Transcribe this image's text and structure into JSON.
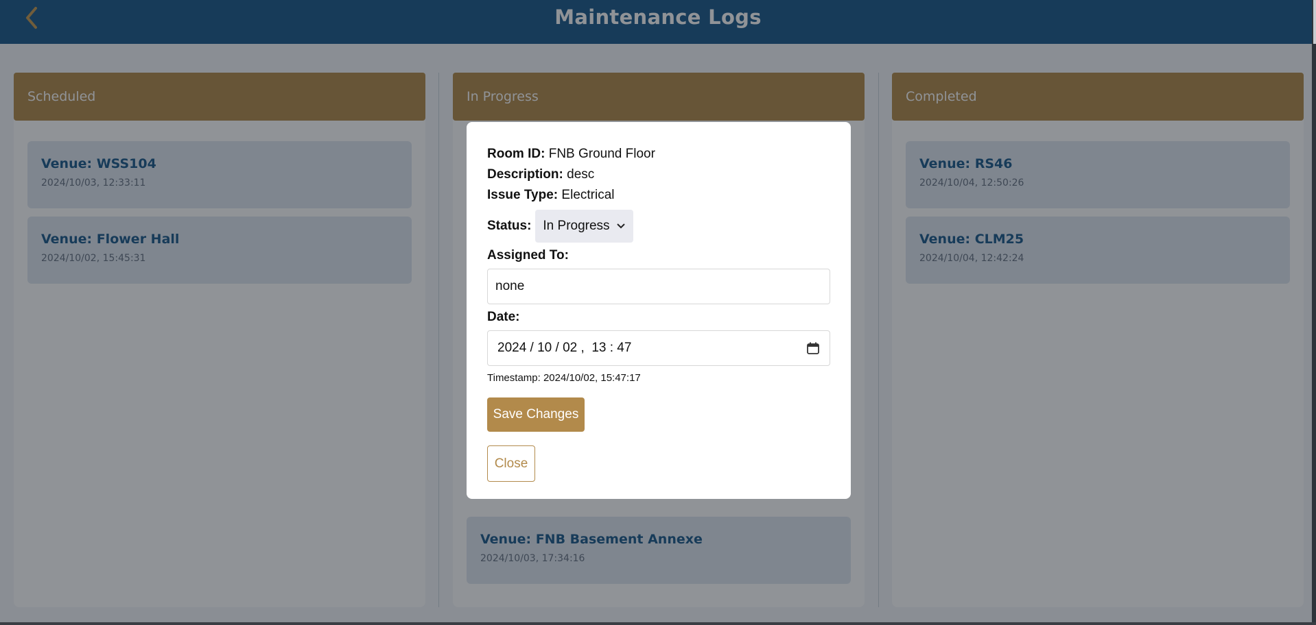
{
  "header": {
    "title": "Maintenance Logs"
  },
  "columns": [
    {
      "title": "Scheduled",
      "cards": [
        {
          "venue": "Venue: WSS104",
          "date": "2024/10/03, 12:33:11"
        },
        {
          "venue": "Venue: Flower Hall",
          "date": "2024/10/02, 15:45:31"
        }
      ]
    },
    {
      "title": "In Progress",
      "cards": [
        {
          "venue": "Venue: FNB Basement Annexe",
          "date": "2024/10/03, 17:34:16"
        }
      ]
    },
    {
      "title": "Completed",
      "cards": [
        {
          "venue": "Venue: RS46",
          "date": "2024/10/04, 12:50:26"
        },
        {
          "venue": "Venue: CLM25",
          "date": "2024/10/04, 12:42:24"
        }
      ]
    }
  ],
  "modal": {
    "room_label": "Room ID:",
    "room_value": "FNB Ground Floor",
    "description_label": "Description:",
    "description_value": "desc",
    "issue_label": "Issue Type:",
    "issue_value": "Electrical",
    "status_label": "Status:",
    "status_value": "In Progress",
    "assigned_label": "Assigned To:",
    "assigned_value": "none",
    "date_label": "Date:",
    "date_value": "2024 / 10 / 02 ,  13 : 47",
    "timestamp": "Timestamp: 2024/10/02, 15:47:17",
    "save_label": "Save Changes",
    "close_label": "Close"
  },
  "colors": {
    "header": "#1c5a8a",
    "accent": "#b28a4b",
    "card": "#dfe7f0"
  },
  "icons": [
    "chevron-left-icon",
    "chevron-down-icon",
    "calendar-icon"
  ]
}
